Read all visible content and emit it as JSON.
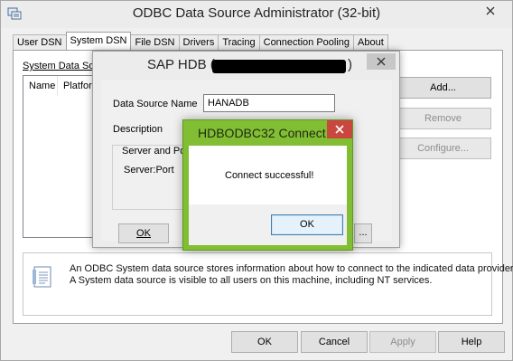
{
  "main_window": {
    "title": "ODBC Data Source Administrator (32-bit)",
    "tabs": [
      {
        "label": "User DSN",
        "active": false
      },
      {
        "label": "System DSN",
        "active": true
      },
      {
        "label": "File DSN",
        "active": false
      },
      {
        "label": "Drivers",
        "active": false
      },
      {
        "label": "Tracing",
        "active": false
      },
      {
        "label": "Connection Pooling",
        "active": false
      },
      {
        "label": "About",
        "active": false
      }
    ],
    "system_dsn_label": "System Data Sou",
    "list_columns": [
      "Name",
      "Platform"
    ],
    "buttons": {
      "add": "Add...",
      "remove": "Remove",
      "configure": "Configure..."
    },
    "info_text": [
      "An ODBC System data source stores information about how to connect to the indicated data provider.",
      "A System data source is visible to all users on this machine, including NT services."
    ],
    "bottom_buttons": {
      "ok": "OK",
      "cancel": "Cancel",
      "apply": "Apply",
      "help": "Help"
    }
  },
  "sap_dialog": {
    "title_prefix": "SAP HDB (",
    "title_suffix": ")",
    "data_source_name_label": "Data Source Name",
    "data_source_name_value": "HANADB",
    "description_label": "Description",
    "server_group_label": "Server and Port",
    "server_port_label": "Server:Port",
    "ok_label": "OK",
    "ellipsis_label": "..."
  },
  "connect_dialog": {
    "title": "HDBODBC32 Connect",
    "message": "Connect successful!",
    "ok_label": "OK"
  },
  "colors": {
    "connect_frame": "#82be33",
    "close_red": "#c9473f",
    "focus_blue": "#3c7fb1"
  },
  "icons": [
    "app-icon",
    "close-icon",
    "info-document-icon"
  ]
}
